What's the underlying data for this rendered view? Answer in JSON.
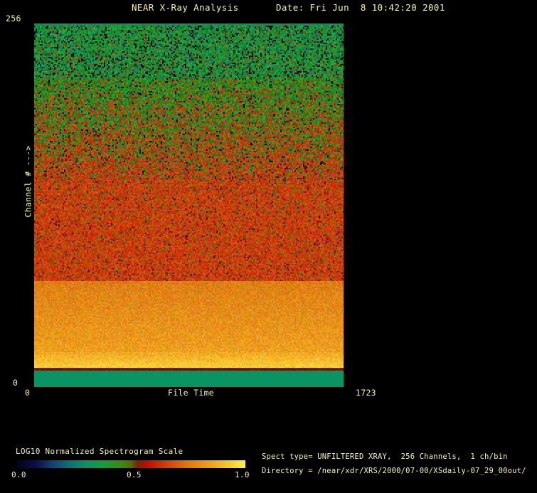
{
  "header": {
    "title": "NEAR X-Ray Analysis",
    "date": "Date: Fri Jun  8 10:42:20 2001"
  },
  "plot": {
    "y_max_label": "256",
    "y_min_label": "0",
    "x_min_label": "0",
    "x_max_label": "1723",
    "x_axis_title": "File Time",
    "y_axis_title": "Channel # --->"
  },
  "colorbar": {
    "label": "LOG10 Normalized Spectrogram Scale",
    "tick_left": "0.0",
    "tick_mid": "0.5",
    "tick_right": "1.0"
  },
  "footer": {
    "spect_type": "Spect type= UNFILTERED XRAY,  256 Channels,  1 ch/bin",
    "directory": "Directory = /near/xdr/XRS/2000/07-00/XSdaily-07_29_00out/"
  },
  "colors": {
    "background": "#000000",
    "text": "#f8f3a6",
    "solid_teal_band": "#0a9463"
  },
  "chart_data": {
    "type": "heatmap",
    "title": "NEAR X-Ray Analysis",
    "subtitle": "Date: Fri Jun  8 10:42:20 2001",
    "xlabel": "File Time",
    "ylabel": "Channel # --->",
    "x_range": [
      0,
      1723
    ],
    "y_range": [
      0,
      256
    ],
    "grid": false,
    "legend_position": "none",
    "colorbar": {
      "label": "LOG10 Normalized Spectrogram Scale",
      "ticks": [
        0.0,
        0.5,
        1.0
      ],
      "gradient_stops": [
        {
          "pos": 0.0,
          "color": "#04041a"
        },
        {
          "pos": 0.08,
          "color": "#0b0d4a"
        },
        {
          "pos": 0.15,
          "color": "#113f70"
        },
        {
          "pos": 0.22,
          "color": "#0e6a78"
        },
        {
          "pos": 0.3,
          "color": "#0f8f62"
        },
        {
          "pos": 0.38,
          "color": "#12a038"
        },
        {
          "pos": 0.46,
          "color": "#3c8a0a"
        },
        {
          "pos": 0.5,
          "color": "#59650a"
        },
        {
          "pos": 0.53,
          "color": "#7c2008"
        },
        {
          "pos": 0.57,
          "color": "#c00c04"
        },
        {
          "pos": 0.65,
          "color": "#cf3f06"
        },
        {
          "pos": 0.75,
          "color": "#e2790e"
        },
        {
          "pos": 0.85,
          "color": "#eda31c"
        },
        {
          "pos": 0.94,
          "color": "#f9cf30"
        },
        {
          "pos": 1.0,
          "color": "#fdf14e"
        }
      ]
    },
    "value_profile_by_channel": [
      {
        "channels": [
          254,
          256
        ],
        "approx_value": 0.33,
        "appearance": "solid teal-green edge row"
      },
      {
        "channels": [
          218,
          254
        ],
        "approx_value": 0.4,
        "appearance": "green noise with dark/navy speckles"
      },
      {
        "channels": [
          146,
          218
        ],
        "approx_value": 0.48,
        "appearance": "green-to-red dithered transition"
      },
      {
        "channels": [
          75,
          146
        ],
        "approx_value": 0.6,
        "appearance": "red noise with sparse green flecks"
      },
      {
        "channels": [
          13,
          75
        ],
        "approx_value": 0.78,
        "appearance": "orange brightening to yellow toward low channels"
      },
      {
        "channels": [
          0,
          13
        ],
        "approx_value": 0.33,
        "appearance": "solid teal-green band"
      }
    ],
    "spectrogram_bands": [
      {
        "from": 0.0,
        "to": 0.006,
        "mode": "solid",
        "color": "#0f9154",
        "jitter": 10
      },
      {
        "from": 0.006,
        "to": 0.15,
        "mode": "dither",
        "colorA": "#1b8f33",
        "colorB": "#a8420e",
        "pB_start": 0.04,
        "pB_end": 0.15,
        "speckles": [
          {
            "color": "#04140d",
            "p": 0.13
          },
          {
            "color": "#0b2d52",
            "p": 0.035
          },
          {
            "color": "#0c8f6e",
            "p": 0.1
          }
        ],
        "jitter": 30
      },
      {
        "from": 0.15,
        "to": 0.43,
        "mode": "dither",
        "colorA": "#268a22",
        "colorB": "#bc3e0a",
        "pB_start": 0.15,
        "pB_end": 0.9,
        "speckles": [
          {
            "color": "#0a1508",
            "p": 0.06
          }
        ],
        "jitter": 32
      },
      {
        "from": 0.43,
        "to": 0.708,
        "mode": "dither",
        "colorA": "#497612",
        "colorB": "#c63f06",
        "pB_start": 0.9,
        "pB_end": 0.97,
        "speckles": [
          {
            "color": "#5c1404",
            "p": 0.05
          }
        ],
        "jitter": 30
      },
      {
        "from": 0.708,
        "to": 0.905,
        "mode": "gradient",
        "colorTop": "#dd7f14",
        "colorBottom": "#eda01f",
        "jitter": 20
      },
      {
        "from": 0.905,
        "to": 0.948,
        "mode": "gradient",
        "colorTop": "#f0aa22",
        "colorBottom": "#ffd23e",
        "jitter": 20
      },
      {
        "from": 0.948,
        "to": 0.955,
        "mode": "solid",
        "color": "#59200a",
        "jitter": 14
      },
      {
        "from": 0.955,
        "to": 1.0,
        "mode": "solid",
        "color": "#0a9463",
        "jitter": 0
      }
    ]
  }
}
